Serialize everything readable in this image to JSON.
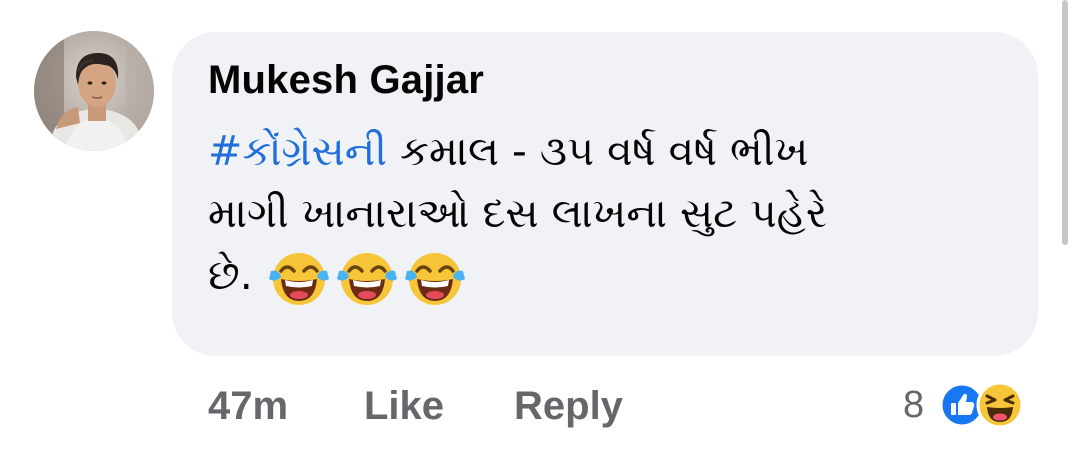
{
  "comment": {
    "author": "Mukesh Gajjar",
    "hashtag": "#કોંગ્રેસની",
    "text_line1_rest": " કમાલ - ૩૫ વર્ષ વર્ષ ભીખ",
    "text_line2": "માગી ખાનારાઓ દસ લાખના સુટ પહેરે",
    "text_line3": "છે.",
    "emojis": [
      "face-with-tears-of-joy-icon",
      "face-with-tears-of-joy-icon",
      "face-with-tears-of-joy-icon"
    ]
  },
  "actions": {
    "time": "47m",
    "like_label": "Like",
    "reply_label": "Reply"
  },
  "reactions": {
    "count": "8",
    "types": [
      "like-icon",
      "haha-icon"
    ]
  },
  "colors": {
    "bubble_bg": "#f0f2f5",
    "hashtag": "#216fdb",
    "secondary_text": "#65676b",
    "like_blue": "#1877f2",
    "haha_yellow": "#f7c638"
  }
}
